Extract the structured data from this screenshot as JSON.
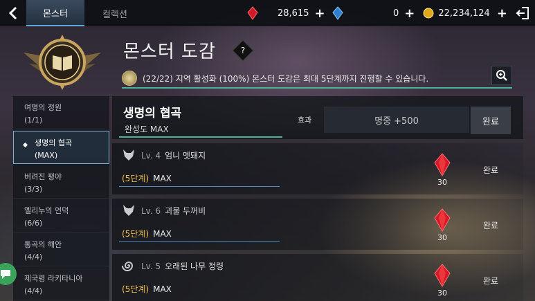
{
  "topbar": {
    "tabs": [
      {
        "label": "몬스터"
      },
      {
        "label": "컬렉션"
      }
    ],
    "resources": [
      {
        "icon": "red-gem-icon",
        "value": "28,615"
      },
      {
        "icon": "blue-gem-icon",
        "value": "0"
      },
      {
        "icon": "gold-coin-icon",
        "value": "22,234,124"
      }
    ]
  },
  "header": {
    "title": "몬스터 도감",
    "help": "?",
    "region_text": "(22/22) 지역 활성화 (100%)  몬스터 도감은 최대 5단계까지 진행할 수 있습니다."
  },
  "sidebar": {
    "items": [
      {
        "label": "여명의 정원",
        "count": "(1/1)"
      },
      {
        "label": "생명의 협곡",
        "count": "(MAX)"
      },
      {
        "label": "버려진 평야",
        "count": "(3/3)"
      },
      {
        "label": "엘리누의 언덕",
        "count": "(6/6)"
      },
      {
        "label": "통곡의 해안",
        "count": "(4/4)"
      },
      {
        "label": "제국령 라키타니아",
        "count": "(4/4)"
      }
    ]
  },
  "main": {
    "title": "생명의 협곡",
    "completion": "완성도 MAX",
    "effect_label": "효과",
    "effect_value": "명중 +500",
    "done_label": "완료"
  },
  "monsters": [
    {
      "level": "Lv. 4",
      "name": "엄니 멧돼지",
      "stage": "(5단계)",
      "stage_value": "MAX",
      "reward": "30",
      "status": "완료"
    },
    {
      "level": "Lv. 6",
      "name": "괴물 두꺼비",
      "stage": "(5단계)",
      "stage_value": "MAX",
      "reward": "30",
      "status": "완료"
    },
    {
      "level": "Lv. 5",
      "name": "오래된 나무 정령",
      "stage": "(5단계)",
      "stage_value": "MAX",
      "reward": "30",
      "status": "완료"
    }
  ],
  "colors": {
    "accent_teal": "#4fb39a",
    "stage_gold": "#f2c14e",
    "gem_red": "#d11a2a",
    "gem_blue": "#2f7fd1",
    "coin_gold": "#e0a81c"
  }
}
